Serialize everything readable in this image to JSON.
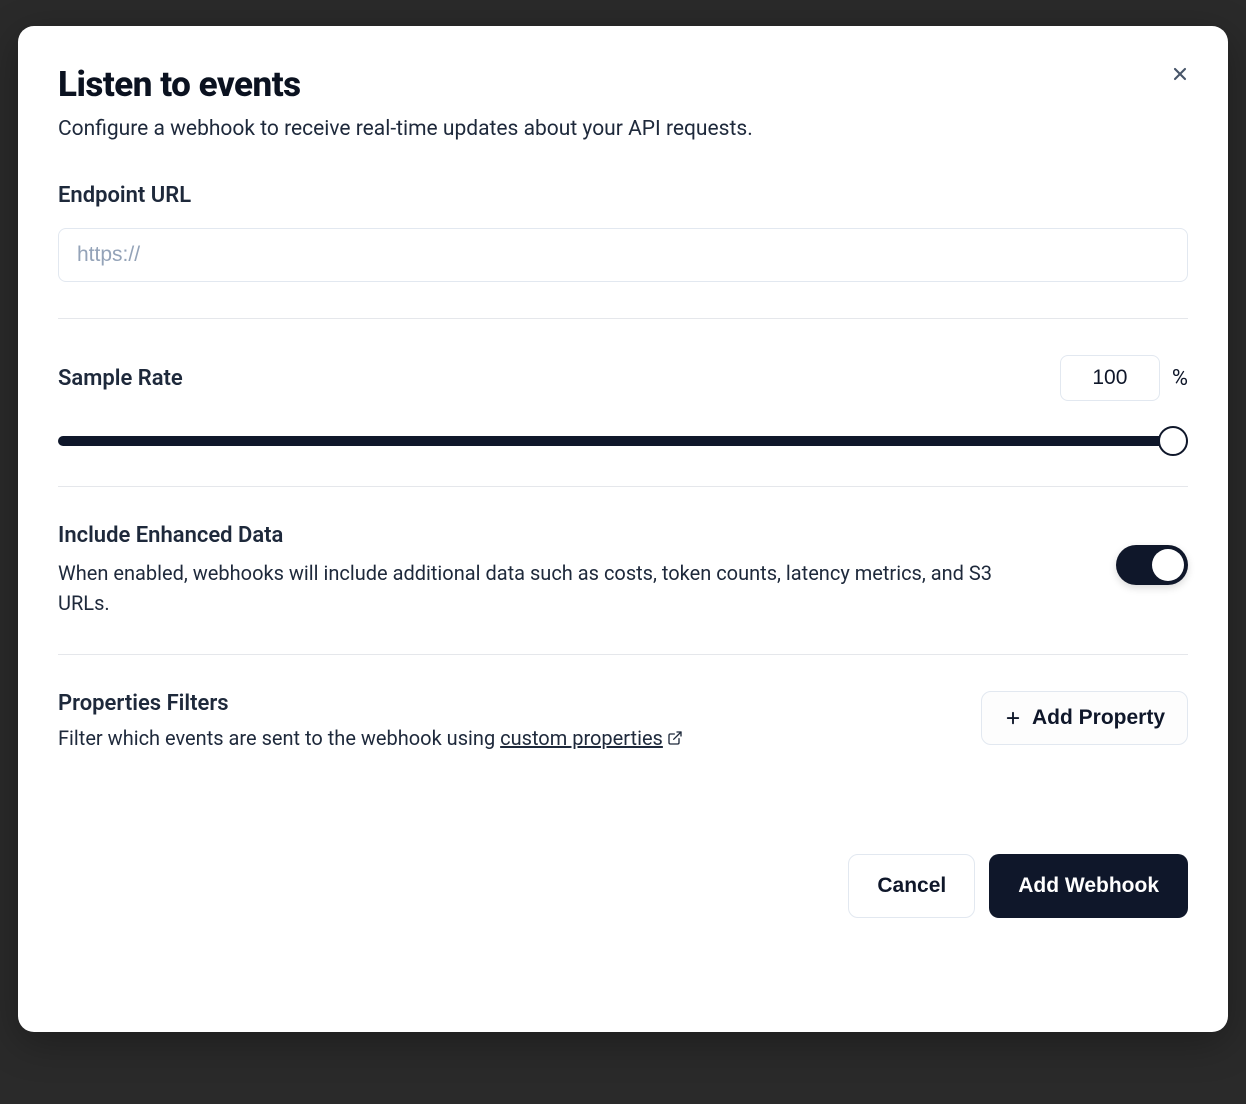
{
  "modal": {
    "title": "Listen to events",
    "subtitle": "Configure a webhook to receive real-time updates about your API requests."
  },
  "endpoint": {
    "label": "Endpoint URL",
    "placeholder": "https://",
    "value": ""
  },
  "sample_rate": {
    "label": "Sample Rate",
    "value": "100",
    "unit": "%"
  },
  "enhanced": {
    "title": "Include Enhanced Data",
    "description": "When enabled, webhooks will include additional data such as costs, token counts, latency metrics, and S3 URLs.",
    "enabled": true
  },
  "filters": {
    "title": "Properties Filters",
    "desc_prefix": "Filter which events are sent to the webhook using ",
    "link_text": "custom properties",
    "add_button": "Add Property"
  },
  "actions": {
    "cancel": "Cancel",
    "submit": "Add Webhook"
  }
}
